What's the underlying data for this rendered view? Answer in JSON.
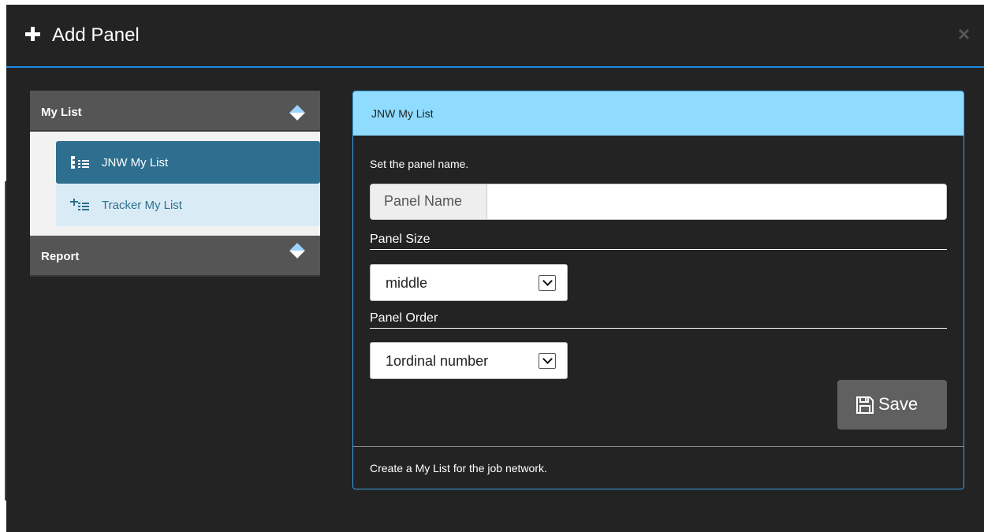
{
  "dialog": {
    "title": "Add Panel",
    "close_label": "×"
  },
  "tree": {
    "groups": [
      {
        "label": "My List",
        "items": [
          {
            "label": "JNW My List"
          },
          {
            "label": "Tracker My List"
          }
        ]
      },
      {
        "label": "Report"
      }
    ]
  },
  "panel": {
    "header": "JNW My List",
    "instruction": "Set the panel name.",
    "name_addon": "Panel Name",
    "name_value": "",
    "size_label": "Panel Size",
    "size_value": "middle",
    "order_label": "Panel Order",
    "order_value": "1ordinal number",
    "save_label": "Save",
    "footer": "Create a My List for the job network."
  },
  "colors": {
    "accent": "#1e88e5",
    "panel_header": "#8fdcff",
    "active_item": "#2e6e8e",
    "dialog_bg": "#232323"
  }
}
